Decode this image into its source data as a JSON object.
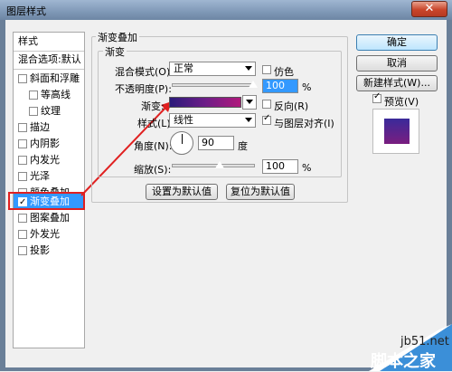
{
  "window": {
    "title": "图层样式",
    "close_glyph": "✕"
  },
  "sidebar": {
    "header": "样式",
    "blend_options": "混合选项:默认",
    "items": [
      {
        "label": "斜面和浮雕",
        "checked": false
      },
      {
        "label": "等高线",
        "checked": false,
        "sub": true
      },
      {
        "label": "纹理",
        "checked": false,
        "sub": true
      },
      {
        "label": "描边",
        "checked": false
      },
      {
        "label": "内阴影",
        "checked": false
      },
      {
        "label": "内发光",
        "checked": false
      },
      {
        "label": "光泽",
        "checked": false
      },
      {
        "label": "颜色叠加",
        "checked": false
      },
      {
        "label": "渐变叠加",
        "checked": true,
        "selected": true
      },
      {
        "label": "图案叠加",
        "checked": false
      },
      {
        "label": "外发光",
        "checked": false
      },
      {
        "label": "投影",
        "checked": false
      }
    ]
  },
  "panel": {
    "group_title": "渐变叠加",
    "subgroup_title": "渐变",
    "blend_mode_label": "混合模式(O):",
    "blend_mode_value": "正常",
    "dither_label": "仿色",
    "opacity_label": "不透明度(P):",
    "opacity_value": "100",
    "opacity_unit": "%",
    "gradient_label": "渐变:",
    "reverse_label": "反向(R)",
    "style_label": "样式(L):",
    "style_value": "线性",
    "align_label": "与图层对齐(I)",
    "align_checked": true,
    "angle_label": "角度(N):",
    "angle_value": "90",
    "angle_unit": "度",
    "scale_label": "缩放(S):",
    "scale_value": "100",
    "scale_unit": "%",
    "make_default_label": "设置为默认值",
    "reset_default_label": "复位为默认值"
  },
  "buttons": {
    "ok": "确定",
    "cancel": "取消",
    "new_style": "新建样式(W)...",
    "preview_label": "预览(V)",
    "preview_checked": true
  },
  "colors": {
    "gradient_start": "#2b1a7a",
    "gradient_end": "#b0197c",
    "selection": "#3399ff",
    "annotation": "#e02020"
  },
  "watermark": {
    "url": "jb51.net",
    "name": "脚本之家"
  }
}
